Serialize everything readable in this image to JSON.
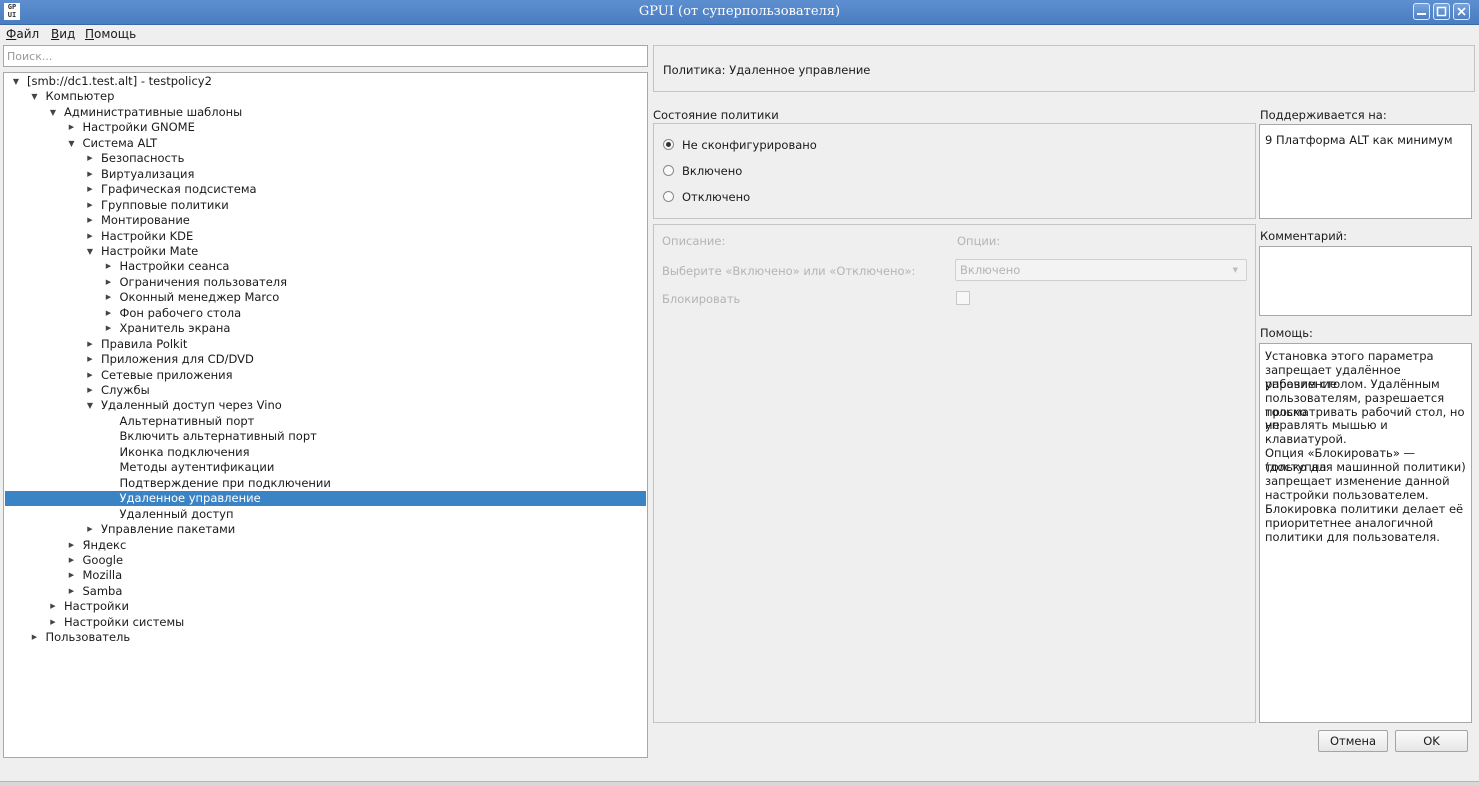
{
  "window": {
    "icon_text": "GP UI",
    "title": "GPUI (от суперпользователя)"
  },
  "menu": [
    {
      "label": "Файл"
    },
    {
      "label": "Вид"
    },
    {
      "label": "Помощь"
    }
  ],
  "search": {
    "placeholder": "Поиск...",
    "value": ""
  },
  "tree": [
    {
      "label": "[smb://dc1.test.alt] - testpolicy2",
      "level": 0,
      "arrow": "down"
    },
    {
      "label": "Компьютер",
      "level": 1,
      "arrow": "down"
    },
    {
      "label": "Административные шаблоны",
      "level": 2,
      "arrow": "down"
    },
    {
      "label": "Настройки GNOME",
      "level": 3,
      "arrow": "right"
    },
    {
      "label": "Система ALT",
      "level": 3,
      "arrow": "down"
    },
    {
      "label": "Безопасность",
      "level": 4,
      "arrow": "right"
    },
    {
      "label": "Виртуализация",
      "level": 4,
      "arrow": "right"
    },
    {
      "label": "Графическая подсистема",
      "level": 4,
      "arrow": "right"
    },
    {
      "label": "Групповые политики",
      "level": 4,
      "arrow": "right"
    },
    {
      "label": "Монтирование",
      "level": 4,
      "arrow": "right"
    },
    {
      "label": "Настройки KDE",
      "level": 4,
      "arrow": "right"
    },
    {
      "label": "Настройки Mate",
      "level": 4,
      "arrow": "down"
    },
    {
      "label": "Настройки сеанса",
      "level": 5,
      "arrow": "right"
    },
    {
      "label": "Ограничения пользователя",
      "level": 5,
      "arrow": "right"
    },
    {
      "label": "Оконный менеджер Marco",
      "level": 5,
      "arrow": "right"
    },
    {
      "label": "Фон рабочего стола",
      "level": 5,
      "arrow": "right"
    },
    {
      "label": "Хранитель экрана",
      "level": 5,
      "arrow": "right"
    },
    {
      "label": "Правила Polkit",
      "level": 4,
      "arrow": "right"
    },
    {
      "label": "Приложения для CD/DVD",
      "level": 4,
      "arrow": "right"
    },
    {
      "label": "Сетевые приложения",
      "level": 4,
      "arrow": "right"
    },
    {
      "label": "Службы",
      "level": 4,
      "arrow": "right"
    },
    {
      "label": "Удаленный доступ через Vino",
      "level": 4,
      "arrow": "down"
    },
    {
      "label": "Альтернативный порт",
      "level": 5,
      "arrow": "none"
    },
    {
      "label": "Включить альтернативный порт",
      "level": 5,
      "arrow": "none"
    },
    {
      "label": "Иконка подключения",
      "level": 5,
      "arrow": "none"
    },
    {
      "label": "Методы аутентификации",
      "level": 5,
      "arrow": "none"
    },
    {
      "label": "Подтверждение при подключении",
      "level": 5,
      "arrow": "none"
    },
    {
      "label": "Удаленное управление",
      "level": 5,
      "arrow": "none",
      "selected": true
    },
    {
      "label": "Удаленный доступ",
      "level": 5,
      "arrow": "none"
    },
    {
      "label": "Управление пакетами",
      "level": 4,
      "arrow": "right"
    },
    {
      "label": "Яндекс",
      "level": 3,
      "arrow": "right"
    },
    {
      "label": "Google",
      "level": 3,
      "arrow": "right"
    },
    {
      "label": "Mozilla",
      "level": 3,
      "arrow": "right"
    },
    {
      "label": "Samba",
      "level": 3,
      "arrow": "right"
    },
    {
      "label": "Настройки",
      "level": 2,
      "arrow": "right"
    },
    {
      "label": "Настройки системы",
      "level": 2,
      "arrow": "right"
    },
    {
      "label": "Пользователь",
      "level": 1,
      "arrow": "right"
    }
  ],
  "policy": {
    "header": "Политика: Удаленное управление",
    "state_label": "Состояние политики",
    "states": [
      {
        "label": "Не сконфигурировано",
        "checked": true
      },
      {
        "label": "Включено",
        "checked": false
      },
      {
        "label": "Отключено",
        "checked": false
      }
    ],
    "description_label": "Описание:",
    "options_label": "Опции:",
    "choose_label": "Выберите «Включено» или «Отключено»:",
    "choose_value": "Включено",
    "lock_label": "Блокировать",
    "lock_checked": false
  },
  "side": {
    "supported_label": "Поддерживается на:",
    "supported_value": "9 Платформа ALT как минимум",
    "comment_label": "Комментарий:",
    "comment_value": "",
    "help_label": "Помощь:",
    "help_lines": [
      "Установка этого параметра",
      "запрещает удалённое управление",
      "рабочим столом. Удалённым",
      "пользователям, разрешается только",
      "просматривать рабочий стол, но не",
      "управлять мышью и клавиатурой.",
      "",
      "Опция «Блокировать» — (доступна",
      "только для машинной политики)",
      "запрещает изменение данной",
      "настройки пользователем.",
      "Блокировка политики делает её",
      "приоритетнее аналогичной",
      "политики для пользователя."
    ]
  },
  "buttons": {
    "cancel": "Отмена",
    "ok": "OK"
  },
  "colors": {
    "selection": "#3a84c5",
    "titlebar": "#4a7dc1"
  }
}
